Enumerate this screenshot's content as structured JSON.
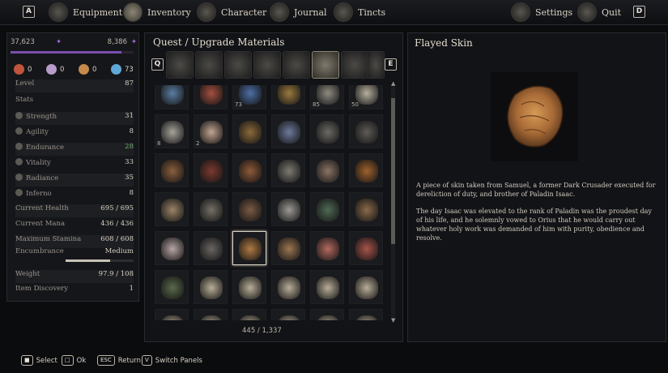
{
  "nav": {
    "left_key": "A",
    "right_key": "D",
    "tabs": [
      {
        "label": "Equipment",
        "icon": "helmet-icon"
      },
      {
        "label": "Inventory",
        "icon": "bag-icon"
      },
      {
        "label": "Character",
        "icon": "character-icon"
      },
      {
        "label": "Journal",
        "icon": "journal-icon"
      },
      {
        "label": "Tincts",
        "icon": "tincts-icon"
      },
      {
        "label": "Settings",
        "icon": "gear-icon"
      },
      {
        "label": "Quit",
        "icon": "quit-icon"
      }
    ],
    "active": "Inventory"
  },
  "character": {
    "currency_left": "37,623",
    "currency_right": "8,386",
    "resources": [
      {
        "icon": "flesh-icon",
        "value": "0",
        "color": "#c0543c"
      },
      {
        "icon": "orb-icon",
        "value": "0",
        "color": "#b89cc9"
      },
      {
        "icon": "seed-icon",
        "value": "0",
        "color": "#c48a4a"
      },
      {
        "icon": "crystal-icon",
        "value": "73",
        "color": "#5fa7d6"
      }
    ],
    "level_label": "Level",
    "level": "87",
    "stats_header": "Stats",
    "stats": [
      {
        "label": "Strength",
        "value": "31",
        "icon": "strength-icon"
      },
      {
        "label": "Agility",
        "value": "8",
        "icon": "agility-icon"
      },
      {
        "label": "Endurance",
        "value": "28",
        "icon": "endurance-icon",
        "highlight": true
      },
      {
        "label": "Vitality",
        "value": "33",
        "icon": "vitality-icon"
      },
      {
        "label": "Radiance",
        "value": "35",
        "icon": "radiance-icon"
      },
      {
        "label": "Inferno",
        "value": "8",
        "icon": "inferno-icon"
      }
    ],
    "derived": [
      {
        "label": "Current Health",
        "value": "695 / 695"
      },
      {
        "label": "Current Mana",
        "value": "436 / 436"
      },
      {
        "label": "Maximum Stamina",
        "value": "608 / 608"
      },
      {
        "label": "Encumbrance",
        "value": "Medium"
      }
    ],
    "encumbrance_level": 0.65,
    "weight_label": "Weight",
    "weight": "97.9 / 108",
    "discovery_label": "Item Discovery",
    "discovery": "1",
    "highlight_color": "#6db36b"
  },
  "inventory": {
    "title": "Quest / Upgrade Materials",
    "prev_key": "Q",
    "next_key": "E",
    "category_icons": [
      "scroll-icon",
      "book-icon",
      "skull-icon",
      "ring-icon",
      "amulet-icon",
      "material-icon",
      "armor-icon",
      "skull-relic-icon"
    ],
    "active_category": 5,
    "capacity": "445 / 1,337",
    "items": [
      {
        "name": "blue-crystal",
        "count": "",
        "color": "#5a7ea3"
      },
      {
        "name": "red-seed",
        "count": "",
        "color": "#a35040"
      },
      {
        "name": "blue-flower",
        "count": "73",
        "color": "#4d6fa6"
      },
      {
        "name": "gold-branch",
        "count": "",
        "color": "#9a7a3e"
      },
      {
        "name": "shell",
        "count": "85",
        "color": "#8f8b82"
      },
      {
        "name": "bones",
        "count": "50",
        "color": "#b7b0a0"
      },
      {
        "name": "pebbles",
        "count": "8",
        "color": "#a7a39b"
      },
      {
        "name": "parchment",
        "count": "2",
        "color": "#c3a592"
      },
      {
        "name": "bronze-key",
        "count": "",
        "color": "#8c6a3c"
      },
      {
        "name": "blue-lantern",
        "count": "",
        "color": "#6d7a9c"
      },
      {
        "name": "iron-key",
        "count": "",
        "color": "#6c6a66"
      },
      {
        "name": "dark-key",
        "count": "",
        "color": "#5f5c58"
      },
      {
        "name": "rusty-key",
        "count": "",
        "color": "#8c5f3e"
      },
      {
        "name": "red-key",
        "count": "",
        "color": "#7b3a2f"
      },
      {
        "name": "copper-key",
        "count": "",
        "color": "#8e5a38"
      },
      {
        "name": "chain-wheel",
        "count": "",
        "color": "#7d7a73"
      },
      {
        "name": "bead-chain",
        "count": "",
        "color": "#8a7466"
      },
      {
        "name": "lock-pick",
        "count": "",
        "color": "#a0622e"
      },
      {
        "name": "skull",
        "count": "",
        "color": "#9b8468"
      },
      {
        "name": "horseshoe",
        "count": "",
        "color": "#757066"
      },
      {
        "name": "fur",
        "count": "",
        "color": "#7a5a44"
      },
      {
        "name": "pearls",
        "count": "",
        "color": "#9c9a95"
      },
      {
        "name": "green-relic",
        "count": "",
        "color": "#4f6a55"
      },
      {
        "name": "ornate-cross",
        "count": "",
        "color": "#8b6a4a"
      },
      {
        "name": "map",
        "count": "",
        "color": "#b9a7a6"
      },
      {
        "name": "dagger",
        "count": "",
        "color": "#6a6662"
      },
      {
        "name": "flayed-skin",
        "count": "",
        "color": "#b07a44",
        "selected": true
      },
      {
        "name": "hide",
        "count": "",
        "color": "#9c7752"
      },
      {
        "name": "flesh",
        "count": "",
        "color": "#b56a5f"
      },
      {
        "name": "meat",
        "count": "",
        "color": "#a8544b"
      },
      {
        "name": "green-book",
        "count": "",
        "color": "#5b6a4c"
      },
      {
        "name": "note1",
        "count": "",
        "color": "#b9ae98"
      },
      {
        "name": "note2",
        "count": "",
        "color": "#b9ae98"
      },
      {
        "name": "note3",
        "count": "",
        "color": "#b9ae98"
      },
      {
        "name": "note4",
        "count": "",
        "color": "#b9ae98"
      },
      {
        "name": "note5",
        "count": "",
        "color": "#b9ae98"
      },
      {
        "name": "note6",
        "count": "",
        "color": "#b9ae98"
      },
      {
        "name": "note7",
        "count": "",
        "color": "#b9ae98"
      },
      {
        "name": "note8",
        "count": "",
        "color": "#b9ae98"
      },
      {
        "name": "note9",
        "count": "",
        "color": "#b9ae98"
      },
      {
        "name": "note10",
        "count": "",
        "color": "#b9ae98"
      },
      {
        "name": "note11",
        "count": "",
        "color": "#b9ae98"
      }
    ]
  },
  "details": {
    "item_name": "Flayed Skin",
    "description_1": "A piece of skin taken from Samuel, a former Dark Crusader executed for dereliction of duty, and brother of Paladin Isaac.",
    "description_2": "The day Isaac was elevated to the rank of Paladin was the proudest day of his life, and he solemnly vowed to Orius that he would carry out whatever holy work was demanded of him with purity, obedience and resolve."
  },
  "hints": [
    {
      "key": "mouse-left-icon",
      "label": "Select"
    },
    {
      "key": "mouse-right-icon",
      "label": "Ok"
    },
    {
      "key": "ESC",
      "label": "Return"
    },
    {
      "key": "V",
      "label": "Switch Panels"
    }
  ]
}
